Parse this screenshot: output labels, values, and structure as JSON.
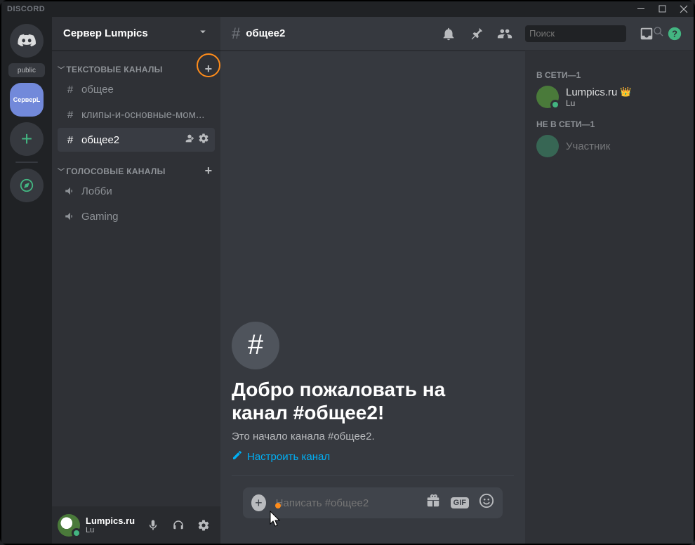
{
  "titlebar": {
    "brand": "DISCORD"
  },
  "guilds": {
    "public_label": "public",
    "server_short": "СерверL"
  },
  "server": {
    "name": "Сервер Lumpics"
  },
  "categories": {
    "text": {
      "label": "ТЕКСТОВЫЕ КАНАЛЫ"
    },
    "voice": {
      "label": "ГОЛОСОВЫЕ КАНАЛЫ"
    }
  },
  "channels": {
    "text": [
      {
        "name": "общее"
      },
      {
        "name": "клипы-и-основные-мом..."
      },
      {
        "name": "общее2"
      }
    ],
    "voice": [
      {
        "name": "Лобби"
      },
      {
        "name": "Gaming"
      }
    ]
  },
  "user": {
    "name": "Lumpics.ru",
    "sub": "Lu"
  },
  "header": {
    "channel": "общее2"
  },
  "search": {
    "placeholder": "Поиск"
  },
  "welcome": {
    "title_line1": "Добро пожаловать на",
    "title_line2": "канал #общее2!",
    "subtitle": "Это начало канала #общее2.",
    "edit_action": "Настроить канал"
  },
  "composer": {
    "placeholder": "Написать #общее2",
    "gif_label": "GIF"
  },
  "members": {
    "online_label": "В СЕТИ—1",
    "offline_label": "НЕ В СЕТИ—1",
    "online": [
      {
        "name": "Lumpics.ru",
        "sub": "Lu",
        "owner": true
      }
    ],
    "offline": [
      {
        "name": "Участник"
      }
    ]
  }
}
